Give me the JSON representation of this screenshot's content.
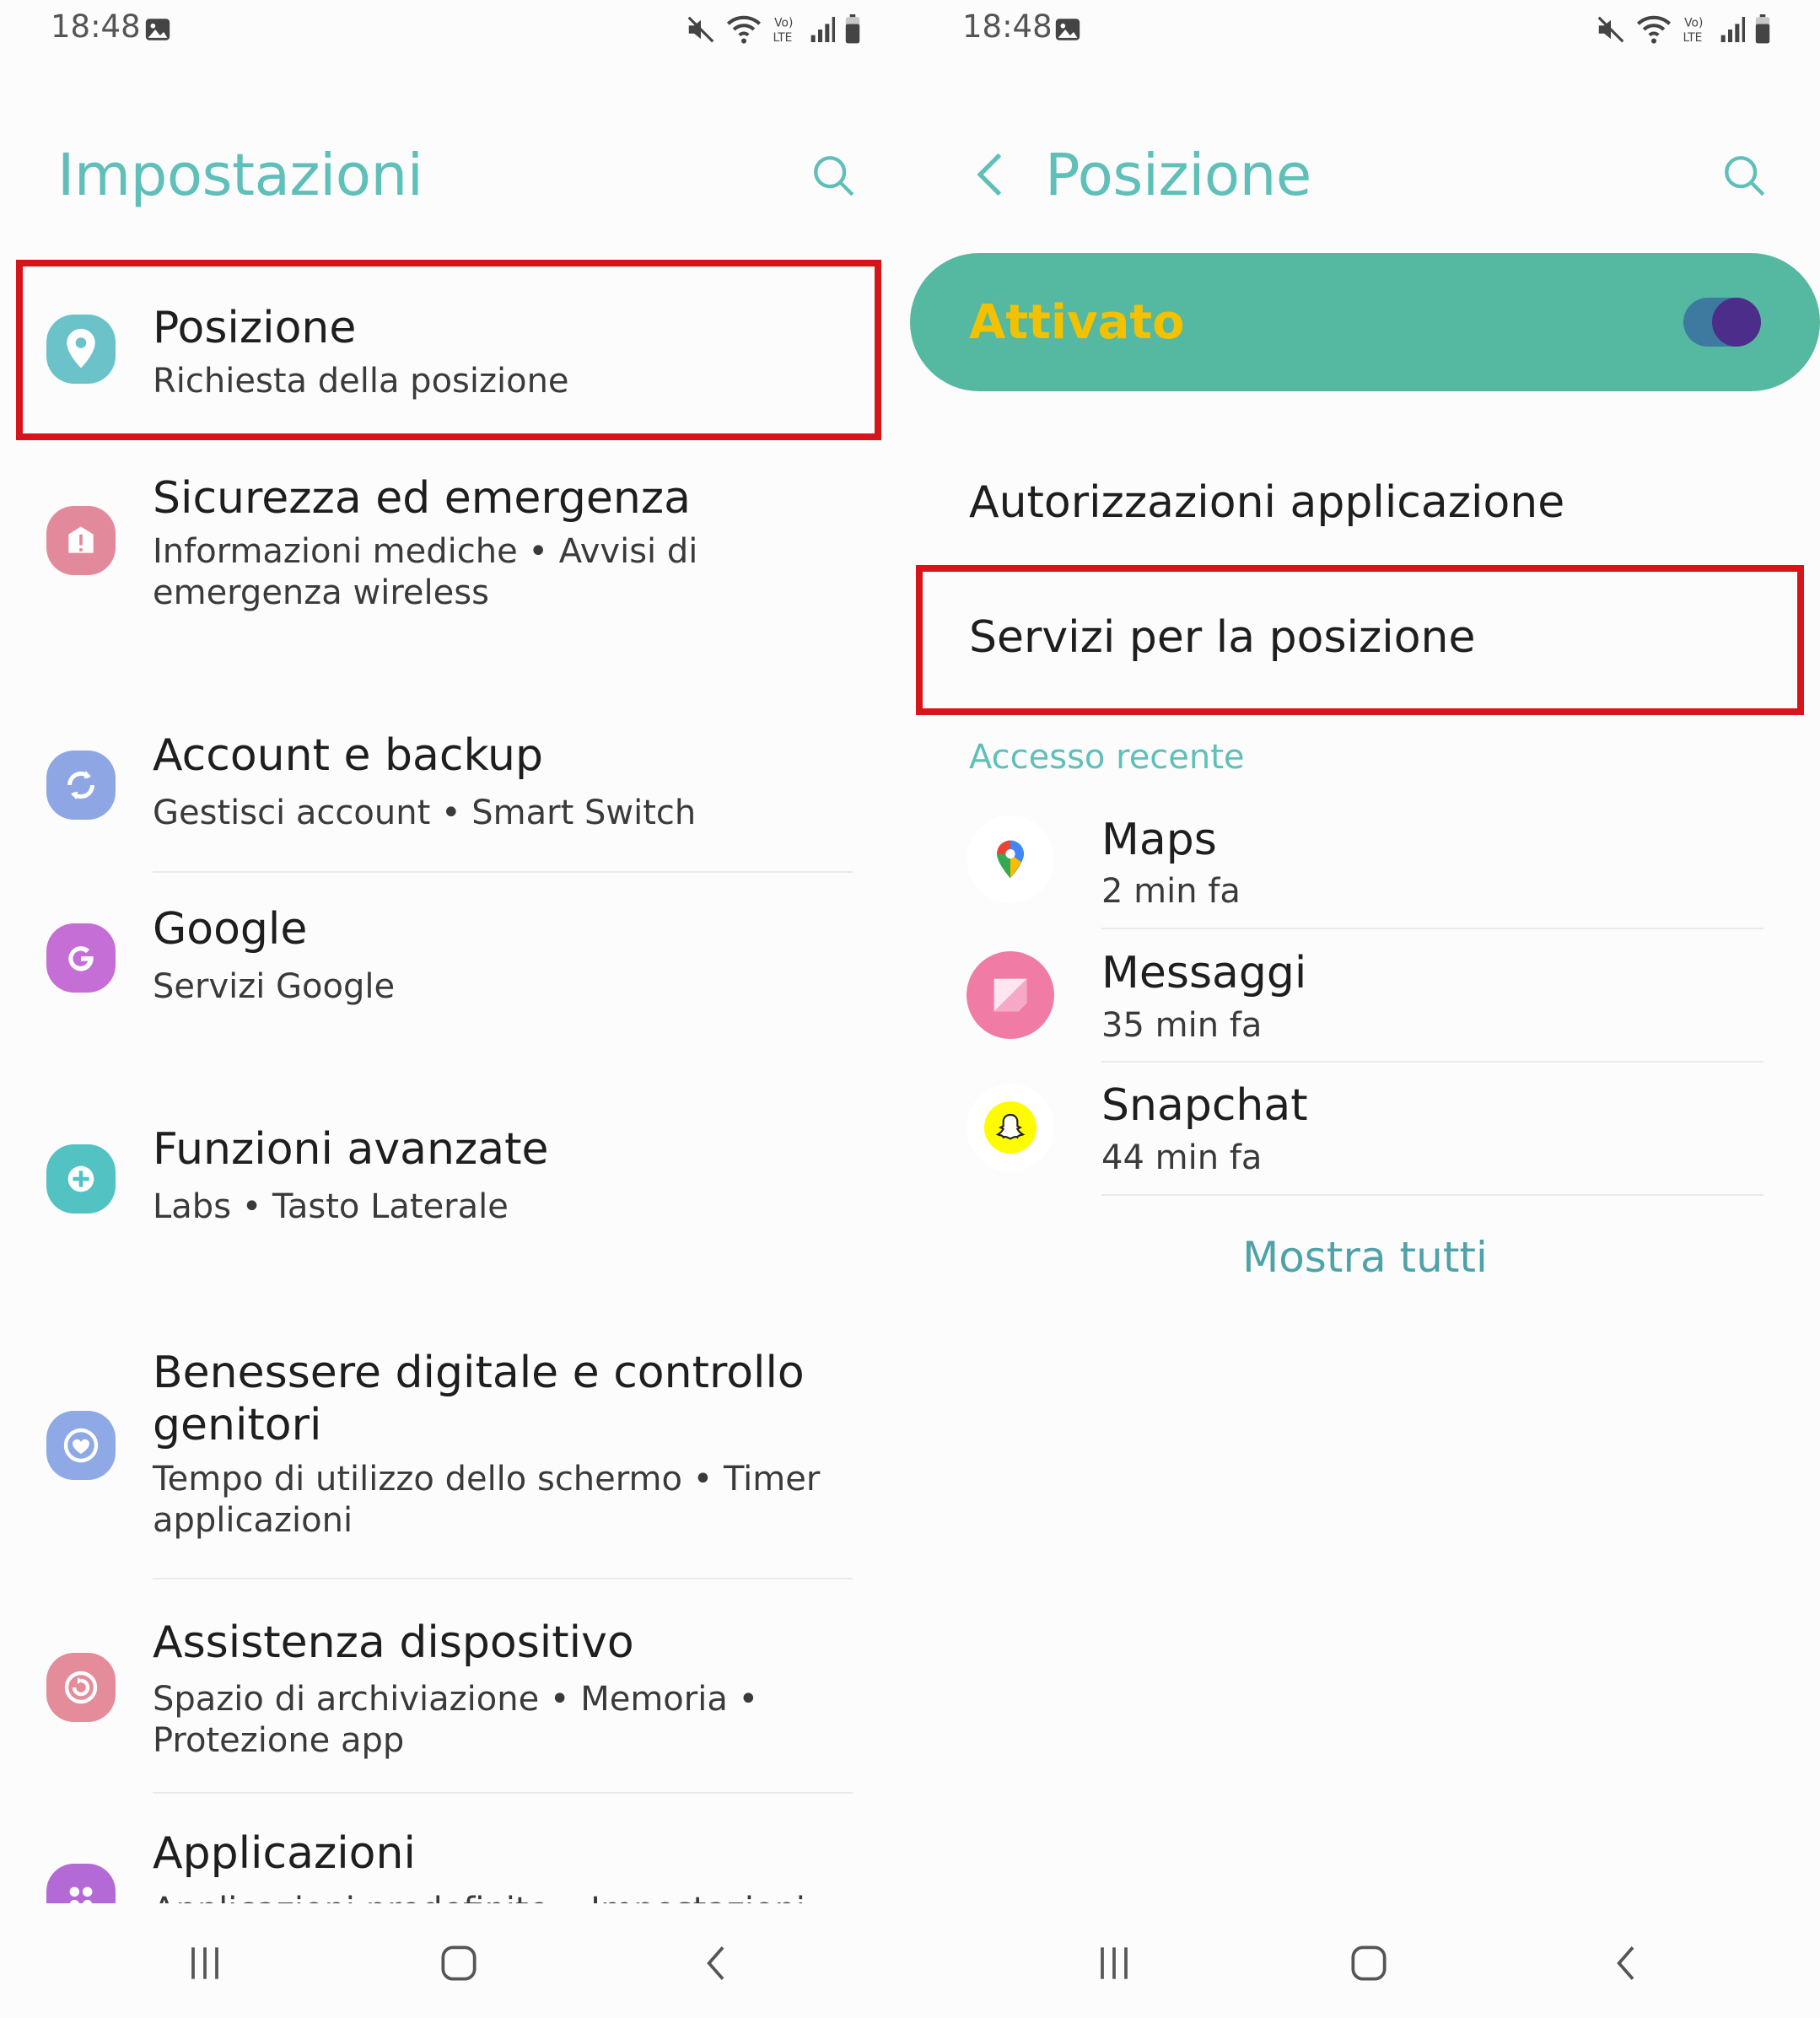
{
  "left": {
    "status": {
      "time": "18:48"
    },
    "title": "Impostazioni",
    "items": [
      {
        "title": "Posizione",
        "subtitle": "Richiesta della posizione"
      },
      {
        "title": "Sicurezza ed emergenza",
        "subtitle": "Informazioni mediche  •  Avvisi di emergenza wireless"
      },
      {
        "title": "Account e backup",
        "subtitle": "Gestisci account  •  Smart Switch"
      },
      {
        "title": "Google",
        "subtitle": "Servizi Google"
      },
      {
        "title": "Funzioni avanzate",
        "subtitle": "Labs  •  Tasto Laterale"
      },
      {
        "title": "Benessere digitale e controllo genitori",
        "subtitle": "Tempo di utilizzo dello schermo  •  Timer applicazioni"
      },
      {
        "title": "Assistenza dispositivo",
        "subtitle": "Spazio di archiviazione  •  Memoria  •  Protezione app"
      },
      {
        "title": "Applicazioni",
        "subtitle": "Applicazioni predefinite  •  Impostazioni"
      }
    ]
  },
  "right": {
    "status": {
      "time": "18:48"
    },
    "title": "Posizione",
    "toggle_label": "Attivato",
    "toggle_on": true,
    "menu": [
      "Autorizzazioni applicazione",
      "Servizi per la posizione"
    ],
    "section_label": "Accesso recente",
    "recent": [
      {
        "name": "Maps",
        "time": "2 min fa"
      },
      {
        "name": "Messaggi",
        "time": "35 min fa"
      },
      {
        "name": "Snapchat",
        "time": "44 min fa"
      }
    ],
    "show_all": "Mostra tutti"
  },
  "colors": {
    "accent": "#5fbfb9",
    "toggle_bar": "#55b8a0",
    "toggle_text": "#f2c200",
    "highlight": "#d7141a"
  },
  "icons": [
    "gallery-icon",
    "mute-icon",
    "wifi-icon",
    "volte-icon",
    "signal-icon",
    "battery-icon",
    "search-icon",
    "back-icon",
    "location-icon",
    "alert-icon",
    "sync-icon",
    "google-icon",
    "plus-icon",
    "heart-icon",
    "refresh-icon",
    "apps-icon",
    "recents-nav-icon",
    "home-nav-icon",
    "back-nav-icon"
  ]
}
